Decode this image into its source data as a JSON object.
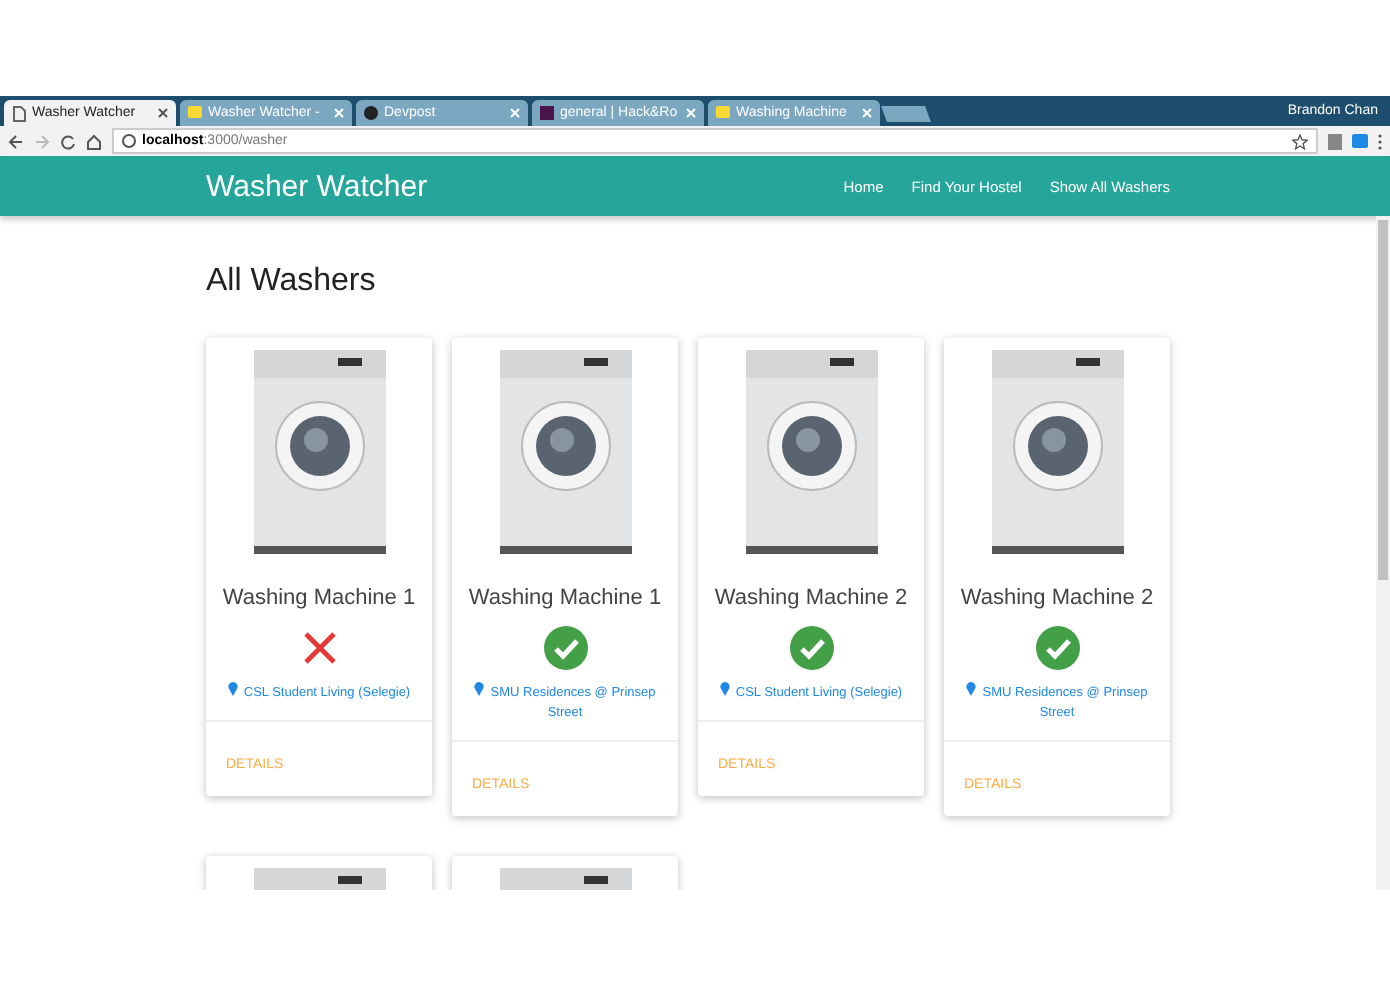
{
  "browser": {
    "tabs": [
      {
        "label": "Washer Watcher",
        "selected": true,
        "kind": "page"
      },
      {
        "label": "Washer Watcher -",
        "selected": false,
        "kind": "chat"
      },
      {
        "label": "Devpost",
        "selected": false,
        "kind": "devpost"
      },
      {
        "label": "general | Hack&Ro",
        "selected": false,
        "kind": "slack"
      },
      {
        "label": "Washing Machine",
        "selected": false,
        "kind": "chat"
      }
    ],
    "user": "Brandon Chan",
    "url_host": "localhost",
    "url_path": ":3000/washer"
  },
  "navbar": {
    "brand": "Washer Watcher",
    "links": [
      "Home",
      "Find Your Hostel",
      "Show All Washers"
    ]
  },
  "heading": "All Washers",
  "washers": [
    {
      "name": "Washing Machine 1",
      "available": false,
      "location": "CSL Student Living (Selegie)",
      "action": "DETAILS"
    },
    {
      "name": "Washing Machine 1",
      "available": true,
      "location": "SMU Residences @ Prinsep Street",
      "action": "DETAILS"
    },
    {
      "name": "Washing Machine 2",
      "available": true,
      "location": "CSL Student Living (Selegie)",
      "action": "DETAILS"
    },
    {
      "name": "Washing Machine 2",
      "available": true,
      "location": "SMU Residences @ Prinsep Street",
      "action": "DETAILS"
    }
  ],
  "more_cards": [
    {
      "kind": "washer-photo"
    },
    {
      "kind": "washer-photo"
    }
  ]
}
